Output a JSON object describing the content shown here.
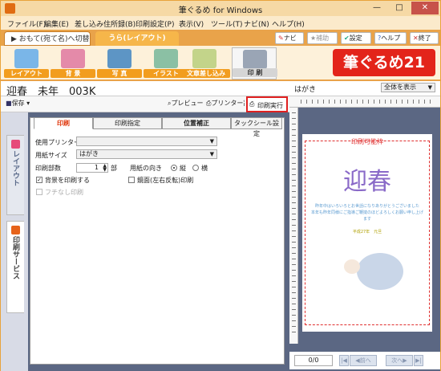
{
  "app_title": "筆ぐるめ for Windows",
  "window_buttons": {
    "minimize": "—",
    "maximize": "□",
    "close": "✕"
  },
  "menu": [
    "ファイル(F)",
    "編集(E)",
    "差し込み住所録(B)",
    "印刷設定(P)",
    "表示(V)",
    "ツール(T)",
    "ナビ(N)",
    "ヘルプ(H)"
  ],
  "mode_tabs": {
    "omote": "おもて(宛て名)へ切替",
    "ura": "うら(レイアウト)"
  },
  "top_buttons": {
    "navi": "ナビ",
    "assist": "補助",
    "settings": "設定",
    "help": "ヘルプ",
    "exit": "終了"
  },
  "ribbon_tabs": [
    "レイアウト",
    "背 景",
    "写 真",
    "イラスト",
    "文章差し込み",
    "印 刷"
  ],
  "logo_text": "筆ぐるめ21",
  "document_title": "迎春　未年　003K",
  "toolbar": {
    "save": "保存",
    "preview": "プレビュー",
    "printer_settings": "プリンター設定",
    "print_exec": "印刷実行"
  },
  "side_tabs": [
    "レイアウト",
    "印刷サービス"
  ],
  "form_tabs": [
    "印刷",
    "印刷指定",
    "位置補正",
    "タックシール設定"
  ],
  "form": {
    "printer_label": "使用プリンター",
    "printer_value": "",
    "paper_label": "用紙サイズ",
    "paper_value": "はがき",
    "copies_label": "印刷部数",
    "copies_value": "1",
    "copies_unit": "部",
    "orientation_label": "用紙の向き",
    "orientation_portrait": "縦",
    "orientation_landscape": "横",
    "background_print_label": "背景を印刷する",
    "background_print_checked": true,
    "mirror_label": "鏡面(左右反転)印刷",
    "mirror_checked": false,
    "borderless_label": "フチなし印刷",
    "borderless_checked": false
  },
  "preview": {
    "paper_label": "はがき",
    "zoom_value": "全体を表示",
    "printable_label": "印刷可能枠",
    "greeting_art": "迎春",
    "body_lines": [
      "昨年中はいろいろとお世話になりありがとうございました",
      "本年も昨年同様にご指導ご鞭撻のほどよろしくお願い申し上げます"
    ],
    "year_line": "平成27年　元旦",
    "page_counter": "0/0",
    "prev_button": "前へ",
    "next_button": "次へ"
  },
  "colors": {
    "accent_orange": "#f29d1e",
    "logo_red": "#e3241a",
    "highlight_red": "#e02020",
    "panel_blue": "#5b6783"
  }
}
